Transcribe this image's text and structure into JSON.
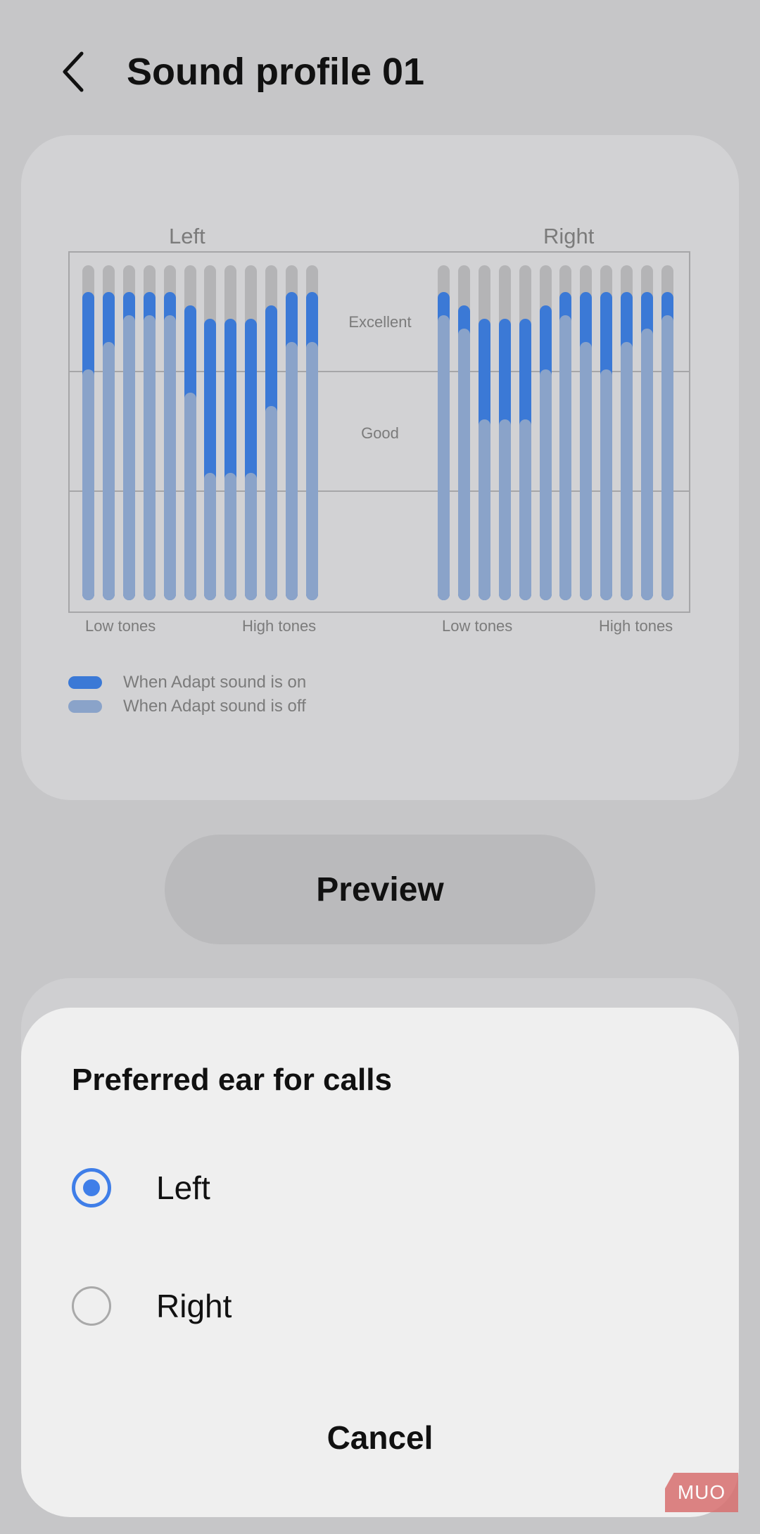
{
  "header": {
    "title": "Sound profile 01",
    "back_icon": "chevron-left-icon"
  },
  "chart": {
    "left_label": "Left",
    "right_label": "Right",
    "band_excellent": "Excellent",
    "band_good": "Good",
    "low_tones": "Low tones",
    "high_tones": "High tones"
  },
  "chart_data": {
    "type": "bar",
    "series": [
      {
        "name": "When Adapt sound is on",
        "color": "#3b79d6",
        "left": [
          0.92,
          0.92,
          0.92,
          0.92,
          0.92,
          0.88,
          0.84,
          0.84,
          0.84,
          0.88,
          0.92,
          0.92
        ],
        "right": [
          0.92,
          0.88,
          0.84,
          0.84,
          0.84,
          0.88,
          0.92,
          0.92,
          0.92,
          0.92,
          0.92,
          0.92
        ]
      },
      {
        "name": "When Adapt sound is off",
        "color": "#8aa3c9",
        "left": [
          0.69,
          0.77,
          0.85,
          0.85,
          0.85,
          0.62,
          0.38,
          0.38,
          0.38,
          0.58,
          0.77,
          0.77
        ],
        "right": [
          0.85,
          0.81,
          0.54,
          0.54,
          0.54,
          0.69,
          0.85,
          0.77,
          0.69,
          0.77,
          0.81,
          0.85
        ]
      }
    ]
  },
  "legend": {
    "on": "When Adapt sound is on",
    "off": "When Adapt sound is off"
  },
  "preview_label": "Preview",
  "dialog": {
    "title": "Preferred ear for calls",
    "options": [
      {
        "label": "Left",
        "selected": true
      },
      {
        "label": "Right",
        "selected": false
      }
    ],
    "cancel_label": "Cancel"
  },
  "watermark": "MUO"
}
